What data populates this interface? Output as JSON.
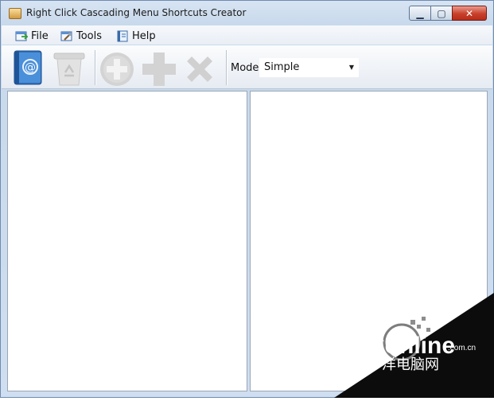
{
  "window": {
    "title": "Right Click Cascading Menu Shortcuts Creator",
    "controls": {
      "minimize": "▁",
      "maximize": "▢",
      "close": "✕"
    }
  },
  "menu": {
    "items": [
      {
        "label": "File",
        "icon": "file-menu-icon"
      },
      {
        "label": "Tools",
        "icon": "tools-menu-icon"
      },
      {
        "label": "Help",
        "icon": "help-menu-icon"
      }
    ]
  },
  "toolbar": {
    "buttons": [
      {
        "name": "address-book-button",
        "icon": "address-book-icon",
        "enabled": true
      },
      {
        "name": "recycle-bin-button",
        "icon": "recycle-bin-icon",
        "enabled": false
      },
      {
        "name": "add-item-button",
        "icon": "circle-plus-icon",
        "enabled": false
      },
      {
        "name": "add-button",
        "icon": "plus-icon",
        "enabled": false
      },
      {
        "name": "delete-button",
        "icon": "x-icon",
        "enabled": false
      }
    ],
    "mode_label": "Mode",
    "mode_value": "Simple"
  },
  "watermark": {
    "brand": "PConline",
    "domain": ".com.cn",
    "chinese": "太平洋电脑网"
  },
  "colors": {
    "frame": "#c8d9ec",
    "close_button": "#c8402a",
    "disabled_icon": "#c9c9c9",
    "address_book": "#2f6fb8"
  }
}
